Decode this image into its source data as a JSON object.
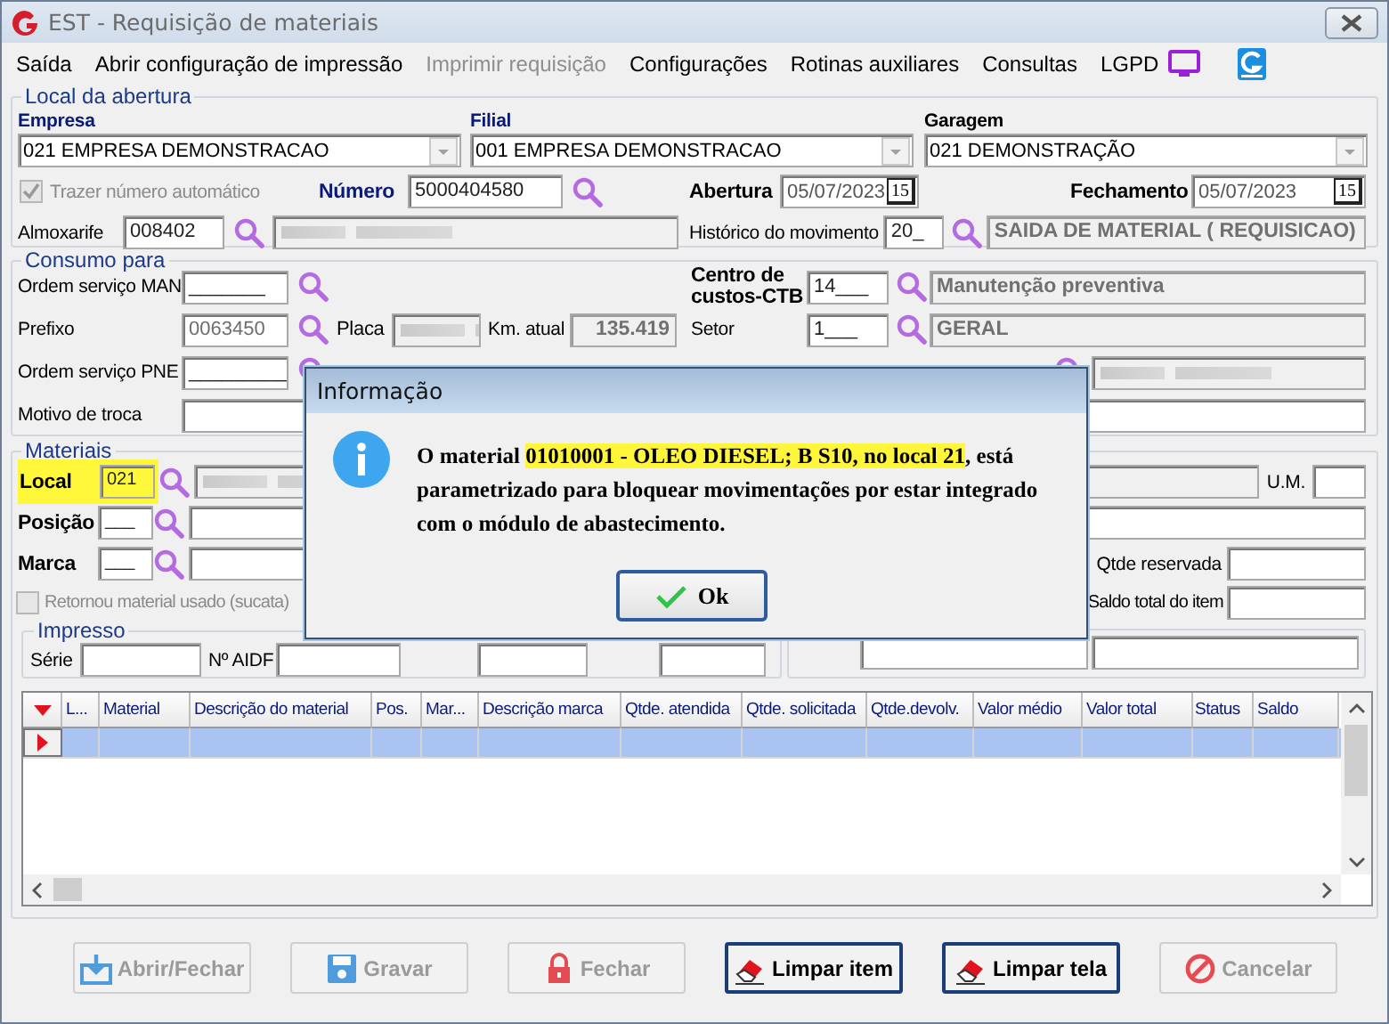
{
  "window": {
    "title": "EST - Requisição de materiais"
  },
  "menu": [
    {
      "label": "Saída",
      "disabled": false
    },
    {
      "label": "Abrir configuração de impressão",
      "disabled": false
    },
    {
      "label": "Imprimir requisição",
      "disabled": true
    },
    {
      "label": "Configurações",
      "disabled": false
    },
    {
      "label": "Rotinas auxiliares",
      "disabled": false
    },
    {
      "label": "Consultas",
      "disabled": false
    },
    {
      "label": "LGPD",
      "disabled": false
    }
  ],
  "local_da_abertura": {
    "title": "Local da abertura",
    "empresa": {
      "label": "Empresa",
      "value": "021 EMPRESA DEMONSTRACAO"
    },
    "filial": {
      "label": "Filial",
      "value": "001 EMPRESA DEMONSTRACAO"
    },
    "garagem": {
      "label": "Garagem",
      "value": "021 DEMONSTRAÇÃO"
    },
    "trazer_numero": {
      "label": "Trazer número automático",
      "checked": true,
      "disabled": true
    },
    "numero": {
      "label": "Número",
      "value": "5000404580"
    },
    "abertura": {
      "label": "Abertura",
      "value": "05/07/2023",
      "calendar": "15"
    },
    "fechamento": {
      "label": "Fechamento",
      "value": "05/07/2023",
      "calendar": "15"
    },
    "almoxarife": {
      "label": "Almoxarife",
      "value": "008402"
    },
    "historico": {
      "label": "Histórico do movimento",
      "value": "20_",
      "description": "SAIDA DE MATERIAL ( REQUISICAO)"
    }
  },
  "consumo_para": {
    "title": "Consumo para",
    "ordem_servico_man": {
      "label": "Ordem serviço MAN",
      "value": "_______"
    },
    "prefixo": {
      "label": "Prefixo",
      "value": "0063450"
    },
    "placa": {
      "label": "Placa"
    },
    "km_atual": {
      "label": "Km. atual",
      "value": "135.419"
    },
    "ordem_servico_pne": {
      "label": "Ordem serviço PNE",
      "value": "_________"
    },
    "motivo_de_troca": {
      "label": "Motivo de troca"
    },
    "centro_de_custos": {
      "label": "Centro de custos-CTB",
      "value": "14___",
      "description": "Manutenção preventiva"
    },
    "setor": {
      "label": "Setor",
      "value": "1___",
      "description": "GERAL"
    }
  },
  "materiais": {
    "title": "Materiais",
    "local": {
      "label": "Local",
      "value": "021",
      "highlighted": true
    },
    "posicao": {
      "label": "Posição",
      "value": "___"
    },
    "marca": {
      "label": "Marca",
      "value": "___"
    },
    "um": {
      "label": "U.M."
    },
    "qtde_reservada": {
      "label": "Qtde reservada"
    },
    "saldo_total": {
      "label": "Saldo total do item"
    },
    "retornou": {
      "label": "Retornou material usado (sucata)",
      "checked": false,
      "disabled": true
    },
    "impresso": {
      "title": "Impresso",
      "serie": {
        "label": "Série"
      },
      "aidf": {
        "label": "Nº AIDF"
      }
    }
  },
  "table": {
    "columns": [
      "L...",
      "Material",
      "Descrição do material",
      "Pos.",
      "Mar...",
      "Descrição marca",
      "Qtde. atendida",
      "Qtde. solicitada",
      "Qtde.devolv.",
      "Valor médio",
      "Valor total",
      "Status",
      "Saldo"
    ],
    "rows": [
      {
        "selected": true
      }
    ]
  },
  "buttons": [
    {
      "label": "Abrir/Fechar",
      "kind": "download",
      "disabled": true
    },
    {
      "label": "Gravar",
      "kind": "save",
      "disabled": true
    },
    {
      "label": "Fechar",
      "kind": "lock",
      "disabled": true
    },
    {
      "label": "Limpar item",
      "kind": "eraser",
      "disabled": false
    },
    {
      "label": "Limpar tela",
      "kind": "eraser",
      "disabled": false
    },
    {
      "label": "Cancelar",
      "kind": "cancel",
      "disabled": true
    }
  ],
  "dialog": {
    "title": "Informação",
    "message": [
      {
        "text": "O material ",
        "highlight": false
      },
      {
        "text": "01010001 - OLEO DIESEL; B S10, no local 21",
        "highlight": true
      },
      {
        "text": ", está parametrizado para bloquear movimentações por estar integrado com o módulo de abastecimento.",
        "highlight": false
      }
    ],
    "button": "Ok"
  }
}
